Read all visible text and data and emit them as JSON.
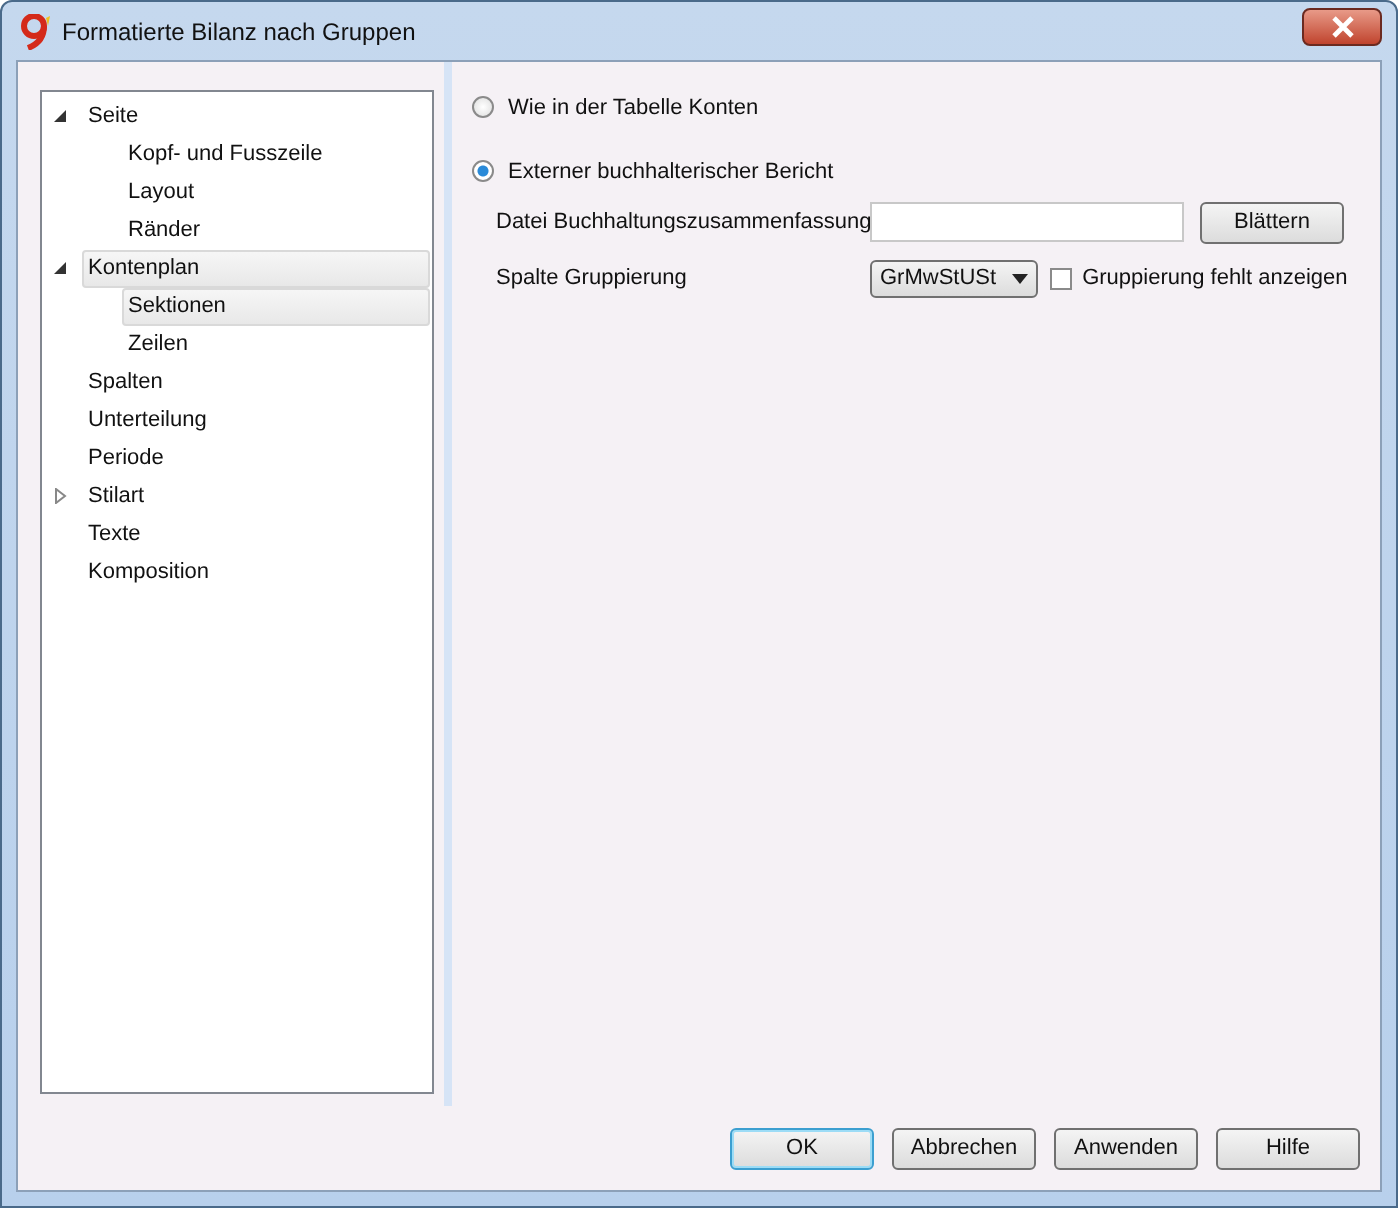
{
  "window": {
    "title": "Formatierte Bilanz nach Gruppen"
  },
  "tree": [
    {
      "label": "Seite",
      "kind": "group",
      "expanded": true,
      "selected": false,
      "children": [
        {
          "label": "Kopf- und Fusszeile",
          "selected": false
        },
        {
          "label": "Layout",
          "selected": false
        },
        {
          "label": "Ränder",
          "selected": false
        }
      ]
    },
    {
      "label": "Kontenplan",
      "kind": "group",
      "expanded": true,
      "selected": true,
      "children": [
        {
          "label": "Sektionen",
          "selected": true
        },
        {
          "label": "Zeilen",
          "selected": false
        }
      ]
    },
    {
      "label": "Spalten",
      "kind": "leaf",
      "selected": false
    },
    {
      "label": "Unterteilung",
      "kind": "leaf",
      "selected": false
    },
    {
      "label": "Periode",
      "kind": "leaf",
      "selected": false
    },
    {
      "label": "Stilart",
      "kind": "group",
      "expanded": false,
      "selected": false
    },
    {
      "label": "Texte",
      "kind": "leaf",
      "selected": false
    },
    {
      "label": "Komposition",
      "kind": "leaf",
      "selected": false
    }
  ],
  "options": [
    {
      "label": "Wie in der Tabelle Konten",
      "selected": false
    },
    {
      "label": "Externer buchhalterischer Bericht",
      "selected": true
    }
  ],
  "file_field": {
    "label": "Datei Buchhaltungszusammenfassung",
    "button": "Blättern"
  },
  "grouping": {
    "label": "Spalte Gruppierung",
    "value": "GrMwStUSt",
    "checkbox_label": "Gruppierung fehlt anzeigen",
    "checked": false
  },
  "buttons": [
    {
      "label": "OK",
      "default": true
    },
    {
      "label": "Abbrechen",
      "default": false
    },
    {
      "label": "Anwenden",
      "default": false
    },
    {
      "label": "Hilfe",
      "default": false
    }
  ]
}
